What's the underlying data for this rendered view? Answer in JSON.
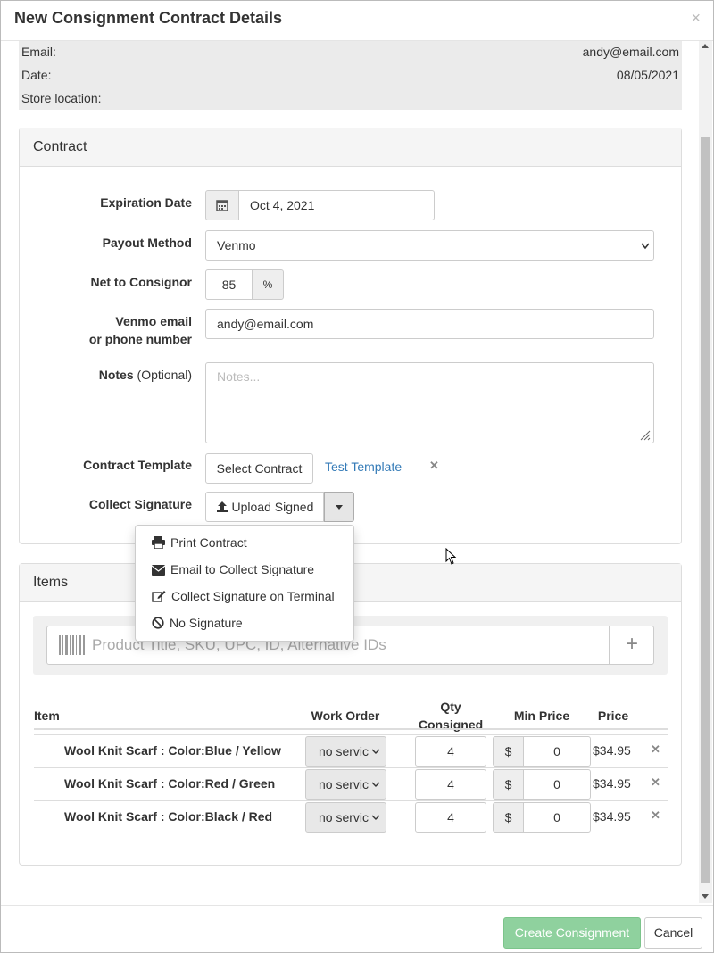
{
  "modal": {
    "title": "New Consignment Contract Details",
    "close_label": "×"
  },
  "customer_info": {
    "email_label": "Email:",
    "email_value": "andy@email.com",
    "date_label": "Date:",
    "date_value": "08/05/2021",
    "store_label": "Store location:",
    "store_value": ""
  },
  "contract": {
    "heading": "Contract",
    "expiration_label": "Expiration Date",
    "expiration_value": "Oct 4, 2021",
    "payout_label": "Payout Method",
    "payout_value": "Venmo",
    "net_label": "Net to Consignor",
    "net_value": "85",
    "net_unit": "%",
    "venmo_label_1": "Venmo email",
    "venmo_label_2": "or phone number",
    "venmo_value": "andy@email.com",
    "notes_label": "Notes",
    "notes_optional": "(Optional)",
    "notes_placeholder": "Notes...",
    "template_label": "Contract Template",
    "select_contract_label": "Select Contract",
    "template_name": "Test Template",
    "remove_label": "✕",
    "signature_label": "Collect Signature",
    "upload_signed_label": "Upload Signed"
  },
  "signature_menu": {
    "items": [
      {
        "label": "Print Contract",
        "icon": "print-icon"
      },
      {
        "label": "Email to Collect Signature",
        "icon": "envelope-icon"
      },
      {
        "label": "Collect Signature on Terminal",
        "icon": "edit-icon"
      },
      {
        "label": "No Signature",
        "icon": "ban-icon"
      }
    ]
  },
  "items_panel": {
    "heading": "Items",
    "search_placeholder": "Product Title, SKU, UPC, ID, Alternative IDs",
    "add_label": "+",
    "columns": {
      "item": "Item",
      "work_order": "Work Order",
      "qty_1": "Qty",
      "qty_2": "Consigned",
      "min_price": "Min Price",
      "price": "Price"
    },
    "rows": [
      {
        "name": "Wool Knit Scarf : Color:Blue / Yellow",
        "work_order": "no servic",
        "qty": "4",
        "currency": "$",
        "min_price": "0",
        "price": "$34.95",
        "remove": "✕"
      },
      {
        "name": "Wool Knit Scarf : Color:Red / Green",
        "work_order": "no servic",
        "qty": "4",
        "currency": "$",
        "min_price": "0",
        "price": "$34.95",
        "remove": "✕"
      },
      {
        "name": "Wool Knit Scarf : Color:Black / Red",
        "work_order": "no servic",
        "qty": "4",
        "currency": "$",
        "min_price": "0",
        "price": "$34.95",
        "remove": "✕"
      }
    ]
  },
  "footer": {
    "create_label": "Create Consignment",
    "cancel_label": "Cancel"
  },
  "colors": {
    "primary_disabled": "#8fd19e",
    "link": "#337ab7",
    "panel_header": "#f5f5f5"
  }
}
